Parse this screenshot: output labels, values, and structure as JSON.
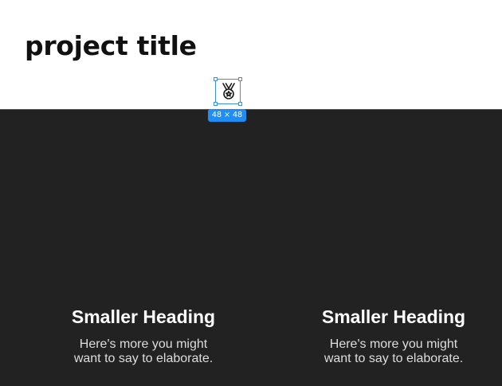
{
  "header": {
    "title": "project title"
  },
  "selection": {
    "icon": "medal-icon",
    "size_label": "48 × 48",
    "accent": "#1e8ef5"
  },
  "features": [
    {
      "heading": "Smaller Heading",
      "body_line1": "Here's more you might",
      "body_line2": "want to say to elaborate."
    },
    {
      "heading": "Smaller Heading",
      "body_line1": "Here's more you might",
      "body_line2": "want to say to elaborate."
    }
  ],
  "colors": {
    "dark_section": "#222222",
    "title_text": "#111111"
  }
}
